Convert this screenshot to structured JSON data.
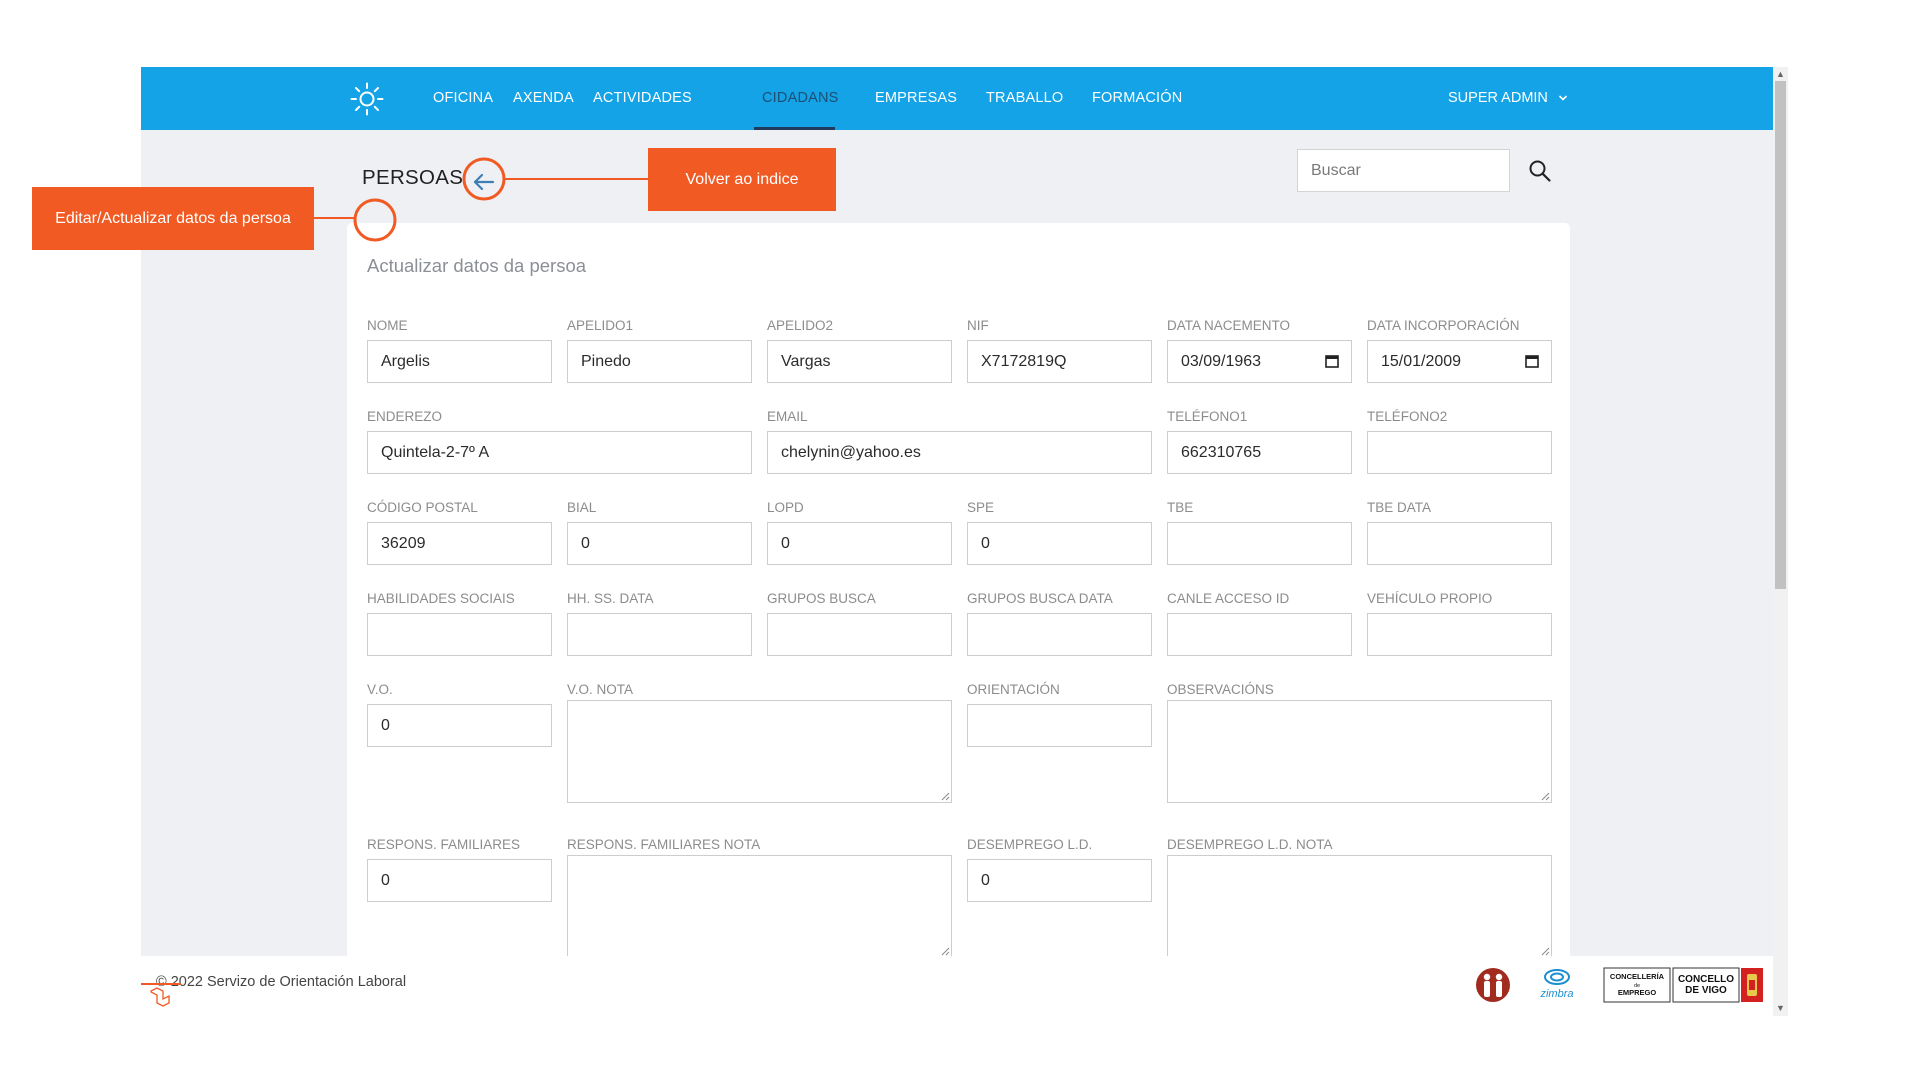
{
  "navbar": {
    "items": [
      {
        "label": "OFICINA",
        "active": false
      },
      {
        "label": "AXENDA",
        "active": false
      },
      {
        "label": "ACTIVIDADES",
        "active": false
      },
      {
        "label": "CIDADANS",
        "active": true
      },
      {
        "label": "EMPRESAS",
        "active": false
      },
      {
        "label": "TRABALLO",
        "active": false
      },
      {
        "label": "FORMACIÓN",
        "active": false
      }
    ],
    "user": "SUPER ADMIN",
    "logo_icon": "sun-icon",
    "color": "#13a3e6"
  },
  "page": {
    "title": "PERSOAS",
    "back_icon": "arrow-left-circle-icon",
    "search_placeholder": "Buscar",
    "search_icon": "search-icon"
  },
  "form": {
    "title": "Actualizar datos da persoa",
    "fields": {
      "nome": {
        "label": "NOME",
        "value": "Argelis"
      },
      "apelido1": {
        "label": "APELIDO1",
        "value": "Pinedo"
      },
      "apelido2": {
        "label": "APELIDO2",
        "value": "Vargas"
      },
      "nif": {
        "label": "NIF",
        "value": "X7172819Q"
      },
      "data_nacemento": {
        "label": "DATA NACEMENTO",
        "value": "03/09/1963"
      },
      "data_incorporacion": {
        "label": "DATA INCORPORACIÓN",
        "value": "15/01/2009"
      },
      "enderezo": {
        "label": "ENDEREZO",
        "value": "Quintela-2-7º A"
      },
      "email": {
        "label": "EMAIL",
        "value": "chelynin@yahoo.es"
      },
      "telefono1": {
        "label": "TELÉFONO1",
        "value": "662310765"
      },
      "telefono2": {
        "label": "TELÉFONO2",
        "value": ""
      },
      "codigo_postal": {
        "label": "CÓDIGO POSTAL",
        "value": "36209"
      },
      "bial": {
        "label": "BIAL",
        "value": "0"
      },
      "lopd": {
        "label": "LOPD",
        "value": "0"
      },
      "spe": {
        "label": "SPE",
        "value": "0"
      },
      "tbe": {
        "label": "TBE",
        "value": ""
      },
      "tbe_data": {
        "label": "TBE DATA",
        "value": ""
      },
      "habilidades_sociais": {
        "label": "HABILIDADES SOCIAIS",
        "value": ""
      },
      "hh_ss_data": {
        "label": "HH. SS. DATA",
        "value": ""
      },
      "grupos_busca": {
        "label": "GRUPOS BUSCA",
        "value": ""
      },
      "grupos_busca_data": {
        "label": "GRUPOS BUSCA DATA",
        "value": ""
      },
      "canle_acceso_id": {
        "label": "CANLE ACCESO ID",
        "value": ""
      },
      "vehiculo_propio": {
        "label": "VEHÍCULO PROPIO",
        "value": ""
      },
      "vo": {
        "label": "V.O.",
        "value": "0"
      },
      "vo_nota": {
        "label": "V.O. NOTA",
        "value": ""
      },
      "orientacion": {
        "label": "ORIENTACIÓN",
        "value": ""
      },
      "observacions": {
        "label": "OBSERVACIÓNS",
        "value": ""
      },
      "respons_familiares": {
        "label": "RESPONS. FAMILIARES",
        "value": "0"
      },
      "respons_familiares_nota": {
        "label": "RESPONS. FAMILIARES NOTA",
        "value": ""
      },
      "desemprego_ld": {
        "label": "DESEMPREGO L.D.",
        "value": "0"
      },
      "desemprego_ld_nota": {
        "label": "DESEMPREGO L.D. NOTA",
        "value": ""
      }
    }
  },
  "footer": {
    "text": "© 2022 Servizo de Orientación Laboral",
    "logos": {
      "zimbra": "zimbra",
      "concelleria_line1": "CONCELLERÍA",
      "concelleria_line2": "de",
      "concelleria_line3": "EMPREGO",
      "concello_line1": "CONCELLO",
      "concello_line2": "DE VIGO"
    }
  },
  "annotations": {
    "back": "Volver ao indice",
    "edit": "Editar/Actualizar datos da persoa",
    "color": "#f15a22"
  }
}
